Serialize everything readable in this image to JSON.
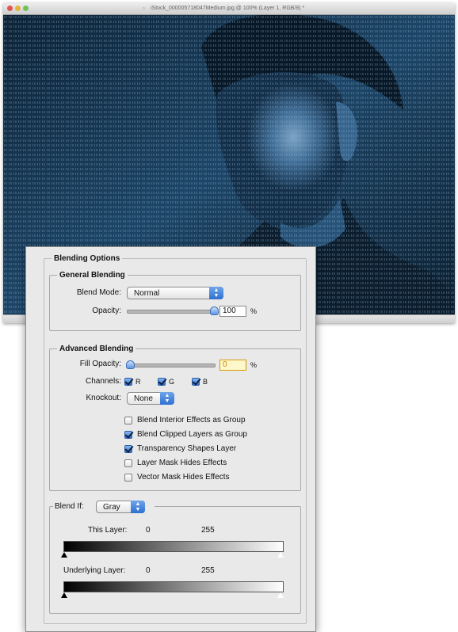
{
  "document": {
    "title": "iStock_000005718047Medium.jpg @ 100% (Layer 1, RGB/8) *"
  },
  "dialog": {
    "heading": "Blending Options",
    "general_blending": {
      "legend": "General Blending",
      "blend_mode_label": "Blend Mode:",
      "blend_mode_value": "Normal",
      "opacity_label": "Opacity:",
      "opacity_value": "100",
      "opacity_level": 1.0,
      "percent": "%"
    },
    "advanced_blending": {
      "legend": "Advanced Blending",
      "fill_opacity_label": "Fill Opacity:",
      "fill_opacity_value": "0",
      "fill_opacity_level": 0.0,
      "percent": "%",
      "channels_label": "Channels:",
      "channels": [
        {
          "label": "R",
          "checked": true
        },
        {
          "label": "G",
          "checked": true
        },
        {
          "label": "B",
          "checked": true
        }
      ],
      "knockout_label": "Knockout:",
      "knockout_value": "None",
      "options": [
        {
          "label": "Blend Interior Effects as Group",
          "checked": false
        },
        {
          "label": "Blend Clipped Layers as Group",
          "checked": true
        },
        {
          "label": "Transparency Shapes Layer",
          "checked": true
        },
        {
          "label": "Layer Mask Hides Effects",
          "checked": false
        },
        {
          "label": "Vector Mask Hides Effects",
          "checked": false
        }
      ]
    },
    "blend_if": {
      "label": "Blend If:",
      "value": "Gray",
      "this_layer": {
        "label": "This Layer:",
        "low": "0",
        "high": "255"
      },
      "underlying_layer": {
        "label": "Underlying Layer:",
        "low": "0",
        "high": "255"
      }
    }
  },
  "colors": {
    "accent": "#2f6fd0",
    "photo_tint": "#2b5a86"
  },
  "icons": {
    "stepper": "up-down-arrows-icon",
    "document": "document-icon"
  }
}
